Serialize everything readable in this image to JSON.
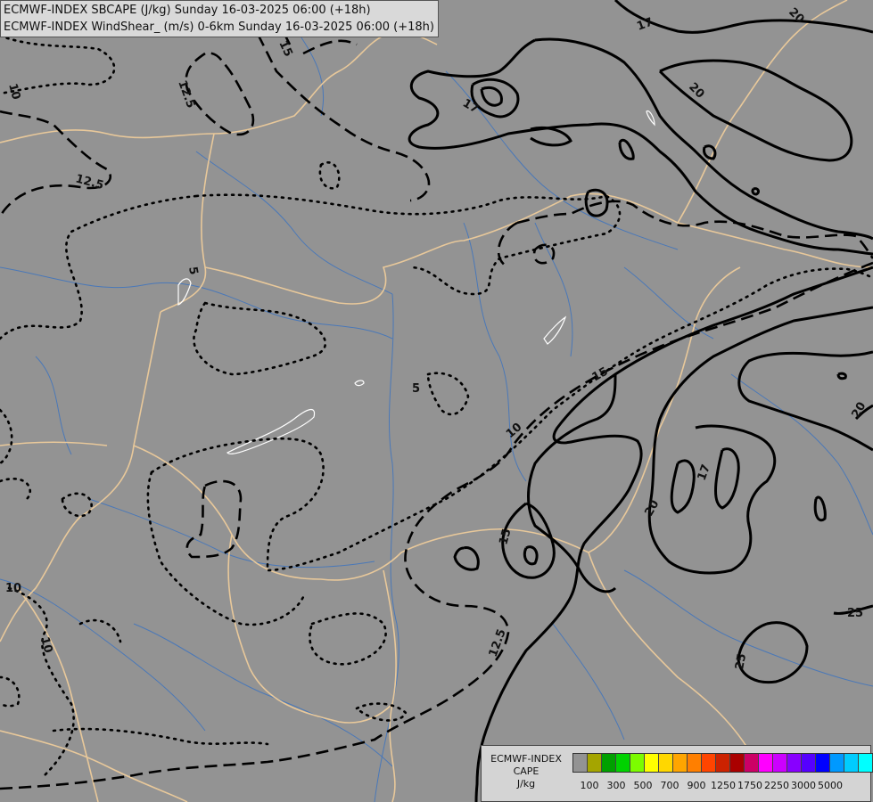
{
  "header": {
    "line1": "ECMWF-INDEX SBCAPE (J/kg) Sunday 16-03-2025 06:00 (+18h)",
    "line2": "ECMWF-INDEX WindShear_ (m/s) 0-6km Sunday 16-03-2025 06:00 (+18h)"
  },
  "contour_labels": {
    "l1": "10",
    "l2": "12.5",
    "l3": "12.5",
    "l4": "15",
    "l5": "17",
    "l6": "20",
    "l7": "20",
    "l8": "5",
    "l9": "5",
    "l10": "10",
    "l11": "15",
    "l12": "20",
    "l13": "17",
    "l14": "15",
    "l15": "12.5",
    "l16": "25",
    "l17": "25",
    "l18": "10",
    "l19": "10",
    "l20": "17"
  },
  "legend": {
    "title_line1": "ECMWF-INDEX",
    "title_line2": "CAPE",
    "title_line3": "J/kg",
    "colors": [
      "#939393",
      "#a5a500",
      "#00a000",
      "#00d200",
      "#7cfc00",
      "#ffff00",
      "#ffd700",
      "#ffa500",
      "#ff7f00",
      "#ff4500",
      "#cc2200",
      "#aa0000",
      "#cc0066",
      "#ff00ff",
      "#cc00ff",
      "#8800ff",
      "#5500ff",
      "#0000ff",
      "#0099ff",
      "#00ccff",
      "#00ffff",
      "#ffffff"
    ],
    "labels": [
      "100",
      "300",
      "500",
      "700",
      "900",
      "1250",
      "1750",
      "2250",
      "3000",
      "5000"
    ]
  }
}
